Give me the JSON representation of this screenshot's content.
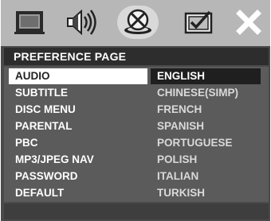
{
  "toolbar": {
    "icons": [
      {
        "name": "general-setup-icon",
        "active": false
      },
      {
        "name": "audio-setup-icon",
        "active": false
      },
      {
        "name": "video-setup-icon",
        "active": true
      },
      {
        "name": "preference-icon",
        "active": false
      },
      {
        "name": "exit-icon",
        "active": false
      }
    ]
  },
  "page": {
    "title": "PREFERENCE PAGE"
  },
  "menu": {
    "items": [
      {
        "label": "AUDIO",
        "selected": true
      },
      {
        "label": "SUBTITLE"
      },
      {
        "label": "DISC MENU"
      },
      {
        "label": "PARENTAL"
      },
      {
        "label": "PBC"
      },
      {
        "label": "MP3/JPEG NAV"
      },
      {
        "label": "PASSWORD"
      },
      {
        "label": "DEFAULT"
      }
    ]
  },
  "options": {
    "items": [
      {
        "label": "ENGLISH",
        "selected": true
      },
      {
        "label": "CHINESE(SIMP)"
      },
      {
        "label": "FRENCH"
      },
      {
        "label": "SPANISH"
      },
      {
        "label": "PORTUGUESE"
      },
      {
        "label": "POLISH"
      },
      {
        "label": "ITALIAN"
      },
      {
        "label": "TURKISH"
      }
    ]
  },
  "colors": {
    "toolbar": "#b7b7b7",
    "title_bar": "#2d2d2d",
    "content": "#5b5b5b",
    "selected_menu_bg": "#ffffff",
    "selected_option_bg": "#1f1f1f"
  }
}
